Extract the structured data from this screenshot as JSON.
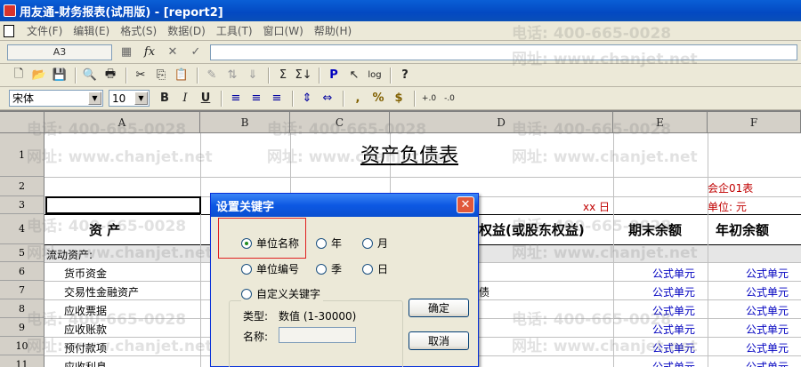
{
  "window": {
    "title": "用友通-财务报表(试用版) - [report2]"
  },
  "menu": [
    "文件(F)",
    "编辑(E)",
    "格式(S)",
    "数据(D)",
    "工具(T)",
    "窗口(W)",
    "帮助(H)"
  ],
  "formula_bar": {
    "cell_ref": "A3",
    "fx": "fx"
  },
  "toolbar2": {
    "font": "宋体",
    "size": "10"
  },
  "columns": [
    "A",
    "B",
    "C",
    "D",
    "E",
    "F"
  ],
  "rows": [
    "1",
    "2",
    "3",
    "4",
    "5",
    "6",
    "7",
    "8",
    "9",
    "10",
    "11"
  ],
  "sheet": {
    "title": "资产负债表",
    "r2_f": "会企01表",
    "r3_d": "xx 日",
    "r3_f": "单位: 元",
    "r4_a": "资        产",
    "r4_d": "权益(或股东权益)",
    "r4_e": "期末余额",
    "r4_f": "年初余额",
    "r5_a": "流动资产:",
    "items": [
      "货币资金",
      "交易性金融资产",
      "应收票据",
      "应收账款",
      "预付款项",
      "应收利息"
    ],
    "r7_d": "债",
    "formula": "公式单元"
  },
  "dialog": {
    "title": "设置关键字",
    "opt_unit_name": "单位名称",
    "opt_year": "年",
    "opt_month": "月",
    "opt_unit_code": "单位编号",
    "opt_quarter": "季",
    "opt_day": "日",
    "opt_custom": "自定义关键字",
    "type_label": "类型:",
    "type_value": "数值 (1-30000)",
    "name_label": "名称:",
    "ok": "确定",
    "cancel": "取消"
  },
  "watermark": {
    "phone": "电话: 400-665-0028",
    "site": "网址: www.chanjet.net"
  }
}
